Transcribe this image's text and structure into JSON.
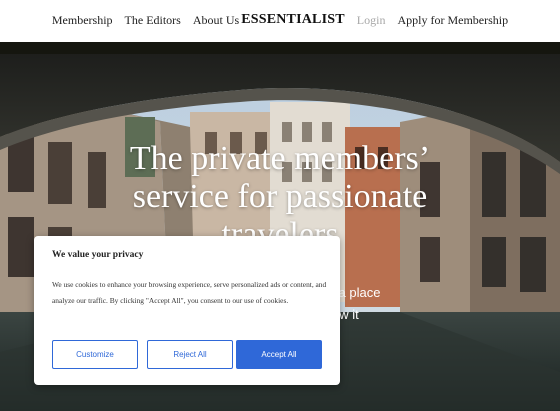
{
  "nav": {
    "links": [
      "Membership",
      "The Editors",
      "About Us"
    ],
    "brand": "ESSENTIALIST",
    "login": "Login",
    "apply": "Apply for Membership"
  },
  "hero": {
    "title_line1": "The private members’",
    "title_line2": "service for passionate",
    "title_line3": "travelers",
    "subtitle_line1": "Expert guidance on visiting a place",
    "subtitle_line2": "and the people who know it"
  },
  "cookie_banner": {
    "title": "We value your privacy",
    "body": "We use cookies to enhance your browsing experience, serve personalized ads or content, and analyze our traffic. By clicking \"Accept All\", you consent to our use of cookies.",
    "customize_label": "Customize",
    "reject_label": "Reject All",
    "accept_label": "Accept All"
  },
  "colors": {
    "accent": "#2f68d8",
    "muted_nav": "#a7a7a7"
  }
}
